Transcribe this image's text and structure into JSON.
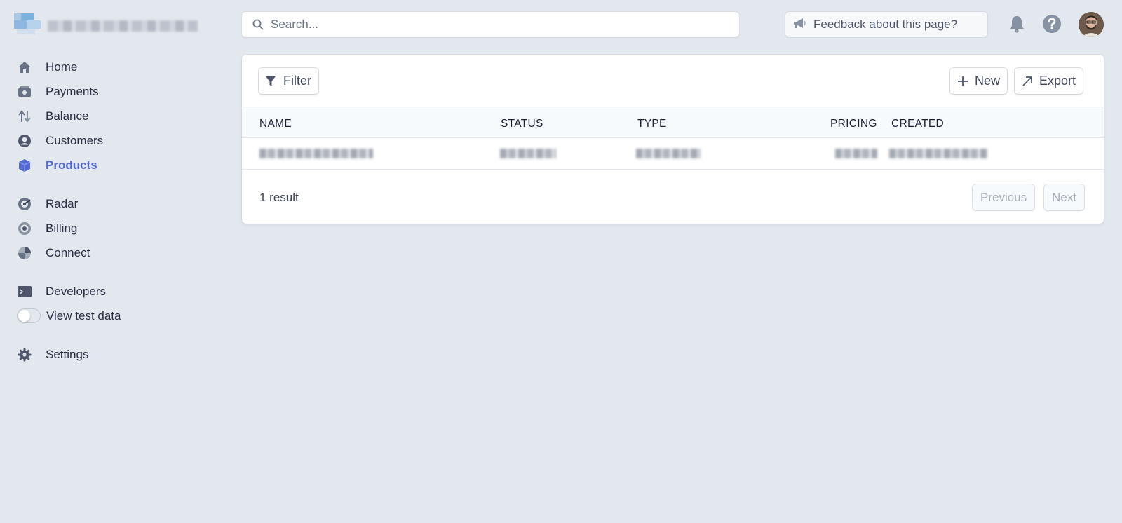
{
  "sidebar": {
    "items": [
      {
        "label": "Home",
        "icon": "home-icon"
      },
      {
        "label": "Payments",
        "icon": "payments-icon"
      },
      {
        "label": "Balance",
        "icon": "balance-icon"
      },
      {
        "label": "Customers",
        "icon": "customers-icon"
      },
      {
        "label": "Products",
        "icon": "products-icon",
        "active": true
      },
      {
        "label": "Radar",
        "icon": "radar-icon"
      },
      {
        "label": "Billing",
        "icon": "billing-icon"
      },
      {
        "label": "Connect",
        "icon": "connect-icon"
      },
      {
        "label": "Developers",
        "icon": "terminal-icon"
      },
      {
        "label": "View test data",
        "icon": "toggle-switch",
        "toggle_on": false
      },
      {
        "label": "Settings",
        "icon": "gear-icon"
      }
    ]
  },
  "header": {
    "search_placeholder": "Search...",
    "feedback_label": "Feedback about this page?"
  },
  "toolbar": {
    "filter_label": "Filter",
    "new_label": "New",
    "export_label": "Export"
  },
  "table": {
    "columns": [
      "NAME",
      "STATUS",
      "TYPE",
      "PRICING",
      "CREATED"
    ]
  },
  "footer": {
    "result_count": "1 result",
    "previous_label": "Previous",
    "next_label": "Next"
  },
  "colors": {
    "background": "#e3e8ef",
    "accent": "#5469d4",
    "text": "#3c4257"
  }
}
